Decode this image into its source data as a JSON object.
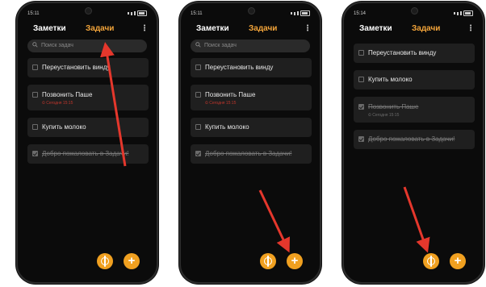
{
  "phones": [
    {
      "time": "15:11",
      "tab_notes": "Заметки",
      "tab_tasks": "Задачи",
      "search_placeholder": "Поиск задач",
      "tasks": [
        {
          "title": "Переустановить винду"
        },
        {
          "title": "Позвонить Паше",
          "date": "⏲ Сегодня 15:15"
        },
        {
          "title": "Купить молоко"
        },
        {
          "title": "Добро пожаловать в Задачи!",
          "done": true
        }
      ],
      "fab_add": "+"
    },
    {
      "time": "15:11",
      "tab_notes": "Заметки",
      "tab_tasks": "Задачи",
      "search_placeholder": "Поиск задач",
      "tasks": [
        {
          "title": "Переустановить винду"
        },
        {
          "title": "Позвонить Паше",
          "date": "⏲ Сегодня 15:15"
        },
        {
          "title": "Купить молоко"
        },
        {
          "title": "Добро пожаловать в Задачи!",
          "done": true
        }
      ],
      "fab_add": "+"
    },
    {
      "time": "15:14",
      "tab_notes": "Заметки",
      "tab_tasks": "Задачи",
      "tasks": [
        {
          "title": "Переустановить винду"
        },
        {
          "title": "Купить молоко"
        },
        {
          "title": "Позвонить Паше",
          "date": "⏲ Сегодня 15:15",
          "done": true
        },
        {
          "title": "Добро пожаловать в Задачи!",
          "done": true
        }
      ],
      "fab_add": "+"
    }
  ],
  "colors": {
    "accent": "#f0a020",
    "tab_active": "#f2a43a",
    "overdue": "#c0362c",
    "arrow": "#e5372c",
    "card": "#1f1f1f",
    "screen": "#0b0b0b"
  },
  "icons": [
    "search-icon",
    "more-vert-icon",
    "voice-fab-icon",
    "plus-icon",
    "alarm-icon"
  ]
}
